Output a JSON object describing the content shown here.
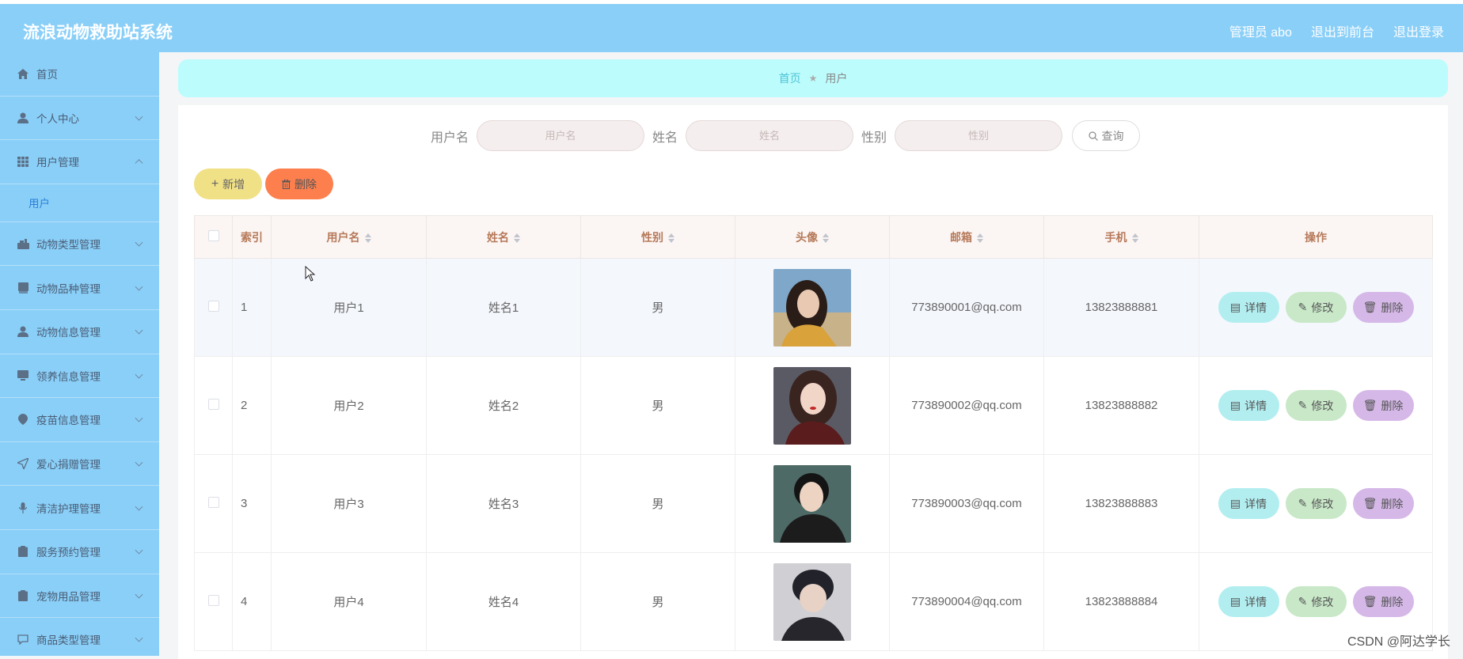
{
  "app": {
    "title": "流浪动物救助站系统"
  },
  "header": {
    "admin_label": "管理员 abo",
    "back_to_front": "退出到前台",
    "logout": "退出登录"
  },
  "sidebar": {
    "items": [
      {
        "label": "首页",
        "icon": "home-icon"
      },
      {
        "label": "个人中心",
        "icon": "user-icon"
      },
      {
        "label": "用户管理",
        "icon": "grid-icon",
        "expanded": true,
        "sub": "用户"
      },
      {
        "label": "动物类型管理",
        "icon": "paw-icon"
      },
      {
        "label": "动物品种管理",
        "icon": "book-icon"
      },
      {
        "label": "动物信息管理",
        "icon": "user-icon"
      },
      {
        "label": "领养信息管理",
        "icon": "monitor-icon"
      },
      {
        "label": "疫苗信息管理",
        "icon": "shield-icon"
      },
      {
        "label": "爱心捐赠管理",
        "icon": "send-icon"
      },
      {
        "label": "清洁护理管理",
        "icon": "mic-icon"
      },
      {
        "label": "服务预约管理",
        "icon": "clipboard-icon"
      },
      {
        "label": "宠物用品管理",
        "icon": "clipboard-icon"
      },
      {
        "label": "商品类型管理",
        "icon": "chat-icon"
      }
    ]
  },
  "breadcrumb": {
    "home": "首页",
    "current": "用户"
  },
  "search": {
    "username_label": "用户名",
    "username_placeholder": "用户名",
    "name_label": "姓名",
    "name_placeholder": "姓名",
    "gender_label": "性别",
    "gender_placeholder": "性别",
    "query_button": "查询"
  },
  "actions": {
    "add": "新增",
    "delete": "删除"
  },
  "table": {
    "headers": {
      "index": "索引",
      "username": "用户名",
      "name": "姓名",
      "gender": "性别",
      "avatar": "头像",
      "email": "邮箱",
      "phone": "手机",
      "ops": "操作"
    },
    "rows": [
      {
        "index": "1",
        "username": "用户1",
        "name": "姓名1",
        "gender": "男",
        "email": "773890001@qq.com",
        "phone": "13823888881"
      },
      {
        "index": "2",
        "username": "用户2",
        "name": "姓名2",
        "gender": "男",
        "email": "773890002@qq.com",
        "phone": "13823888882"
      },
      {
        "index": "3",
        "username": "用户3",
        "name": "姓名3",
        "gender": "男",
        "email": "773890003@qq.com",
        "phone": "13823888883"
      },
      {
        "index": "4",
        "username": "用户4",
        "name": "姓名4",
        "gender": "男",
        "email": "773890004@qq.com",
        "phone": "13823888884"
      }
    ],
    "row_buttons": {
      "detail": "详情",
      "edit": "修改",
      "delete": "删除"
    }
  },
  "watermark": "CSDN @阿达学长"
}
